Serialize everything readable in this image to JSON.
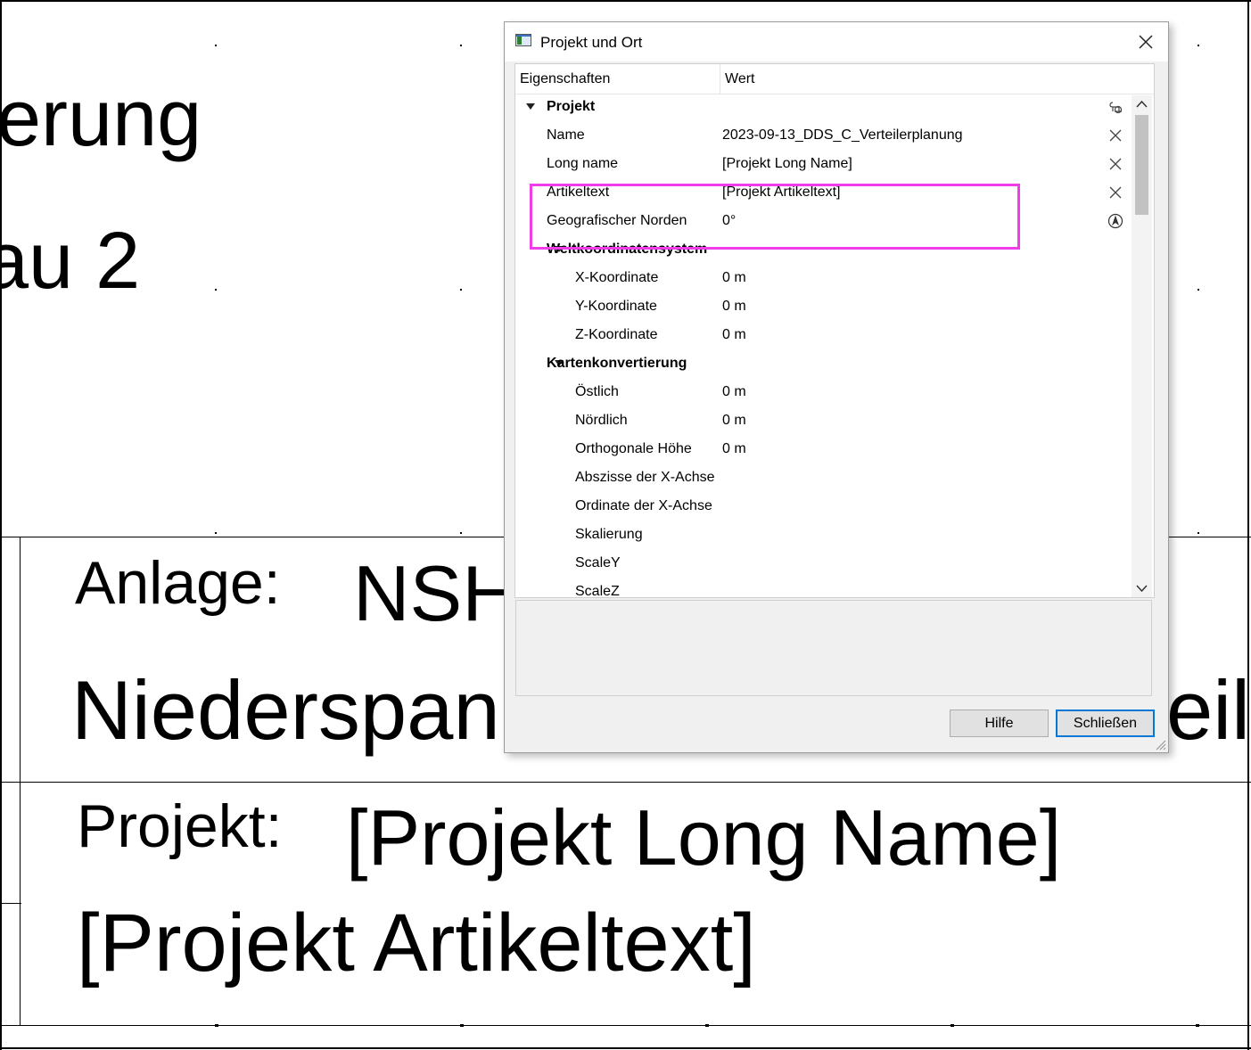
{
  "drawing": {
    "fragment_top": "erung",
    "fragment_middle": "au 2",
    "anlage_label": "Anlage:",
    "anlage_value": "NSH",
    "nieder_text": "Niederspan",
    "eilu_text": "eilu",
    "projekt_label": "Projekt:",
    "projekt_long_name": "[Projekt Long Name]",
    "projekt_artikeltext": "[Projekt Artikeltext]"
  },
  "dialog": {
    "title": "Projekt und Ort",
    "header": {
      "properties": "Eigenschaften",
      "value": "Wert"
    },
    "rows": [
      {
        "label": "Projekt",
        "value": "",
        "bold": true,
        "level": 0,
        "expanded": true,
        "icon": "pin-icon"
      },
      {
        "label": "Name",
        "value": "2023-09-13_DDS_C_Verteilerplanung",
        "level": 1,
        "icon": "clear-icon"
      },
      {
        "label": "Long name",
        "value": "[Projekt Long Name]",
        "level": 1,
        "icon": "clear-icon"
      },
      {
        "label": "Artikeltext",
        "value": "[Projekt Artikeltext]",
        "level": 1,
        "icon": "clear-icon"
      },
      {
        "label": "Geografischer Norden",
        "value": "0°",
        "level": 1,
        "icon": "compass-icon"
      },
      {
        "label": "Weltkoordinatensystem",
        "value": "",
        "bold": true,
        "level": 1,
        "expanded": true
      },
      {
        "label": "X-Koordinate",
        "value": "0 m",
        "level": 2
      },
      {
        "label": "Y-Koordinate",
        "value": "0 m",
        "level": 2
      },
      {
        "label": "Z-Koordinate",
        "value": "0 m",
        "level": 2
      },
      {
        "label": "Kartenkonvertierung",
        "value": "",
        "bold": true,
        "level": 1,
        "expanded": true
      },
      {
        "label": "Östlich",
        "value": "0 m",
        "level": 2
      },
      {
        "label": "Nördlich",
        "value": "0 m",
        "level": 2
      },
      {
        "label": "Orthogonale Höhe",
        "value": "0 m",
        "level": 2
      },
      {
        "label": "Abszisse der X-Achse",
        "value": "",
        "level": 2
      },
      {
        "label": "Ordinate der X-Achse",
        "value": "",
        "level": 2
      },
      {
        "label": "Skalierung",
        "value": "",
        "level": 2
      },
      {
        "label": "ScaleY",
        "value": "",
        "level": 2
      },
      {
        "label": "ScaleZ",
        "value": "",
        "level": 2
      }
    ],
    "buttons": {
      "help": "Hilfe",
      "close": "Schließen"
    },
    "highlight_color": "#ef3de9",
    "accent_color": "#0078d7"
  }
}
